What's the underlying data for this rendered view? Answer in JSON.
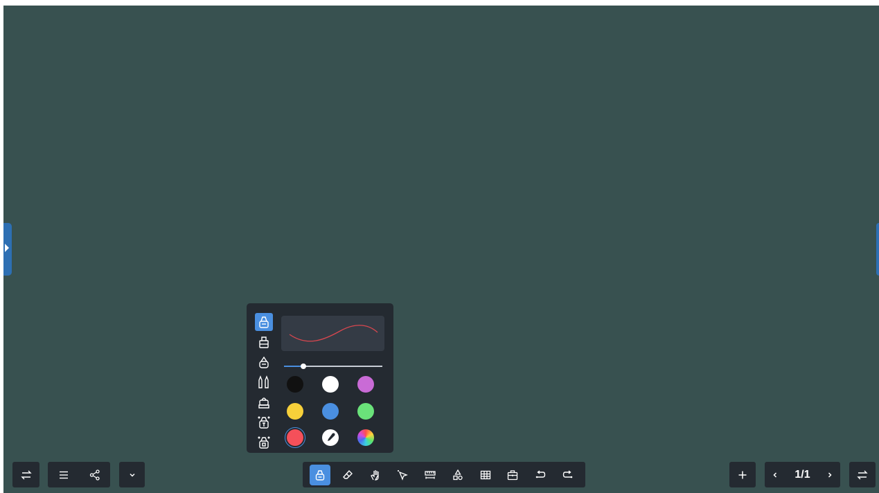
{
  "icons": {
    "left_panel_handle": "chevron-right-icon",
    "right_panel_handle": "chevron-left-icon",
    "switch_left": "swap-arrows-icon",
    "menu": "hamburger-menu-icon",
    "share": "share-icon",
    "collapse": "chevron-down-icon",
    "pen": "pen-icon",
    "eraser": "eraser-icon",
    "gesture": "hand-gesture-icon",
    "select": "pointer-select-icon",
    "ruler": "ruler-icon",
    "shapes": "shapes-icon",
    "table": "table-icon",
    "toolbox": "toolbox-icon",
    "undo": "undo-icon",
    "redo": "redo-icon",
    "add_page": "plus-icon",
    "prev_page": "chevron-left-icon",
    "next_page": "chevron-right-icon",
    "switch_right": "swap-arrows-icon",
    "eyedropper": "eyedropper-icon",
    "color_wheel": "color-wheel-icon"
  },
  "pager": {
    "label": "1/1"
  },
  "pen_panel": {
    "pen_types": [
      {
        "icon": "pen-standard-icon",
        "active": true
      },
      {
        "icon": "pen-highlighter-icon",
        "active": false
      },
      {
        "icon": "pen-fine-icon",
        "active": false
      },
      {
        "icon": "pen-dual-icon",
        "active": false
      },
      {
        "icon": "pen-brush-icon",
        "active": false
      },
      {
        "icon": "pen-text-recognition-icon",
        "active": false
      },
      {
        "icon": "pen-shape-recognition-icon",
        "active": false
      }
    ],
    "stroke_width_fraction": 0.2,
    "preview_color": "#d9474f",
    "colors": [
      {
        "value": "#111111",
        "type": "color"
      },
      {
        "value": "#ffffff",
        "type": "color"
      },
      {
        "value": "#c96bd6",
        "type": "color"
      },
      {
        "value": "#f7d03a",
        "type": "color"
      },
      {
        "value": "#4a8fe0",
        "type": "color"
      },
      {
        "value": "#6ae27a",
        "type": "color"
      },
      {
        "value": "#f5505a",
        "type": "color",
        "selected": true
      },
      {
        "value": "#ffffff",
        "type": "eyedropper"
      },
      {
        "value": "conic",
        "type": "custom"
      }
    ]
  },
  "theme": {
    "board_color": "#385150",
    "toolbar_bg": "#242a31",
    "accent": "#4a8fe0"
  }
}
